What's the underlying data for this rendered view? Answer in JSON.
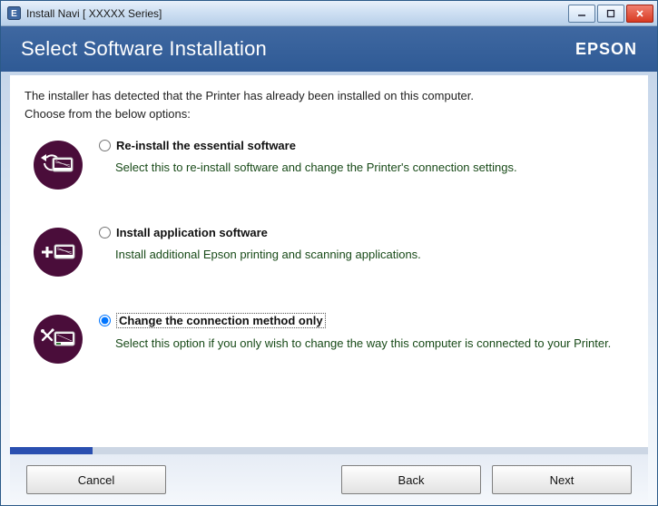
{
  "titlebar": {
    "title": "Install Navi [ XXXXX      Series]"
  },
  "header": {
    "title": "Select Software Installation",
    "brand": "EPSON"
  },
  "content": {
    "intro_line1": "The installer has detected that the Printer has already been installed on this computer.",
    "intro_line2": "Choose from the below options:"
  },
  "options": {
    "selected": "change",
    "reinstall": {
      "label": "Re-install the essential software",
      "desc": "Select this to re-install software and change the Printer's connection settings."
    },
    "apps": {
      "label": "Install application software",
      "desc": "Install additional Epson printing and scanning applications."
    },
    "change": {
      "label": "Change the connection method only",
      "desc": "Select this option if you only wish to change the way this computer is connected to your Printer."
    }
  },
  "footer": {
    "cancel": "Cancel",
    "back": "Back",
    "next": "Next"
  },
  "progress": {
    "percent": 13
  }
}
